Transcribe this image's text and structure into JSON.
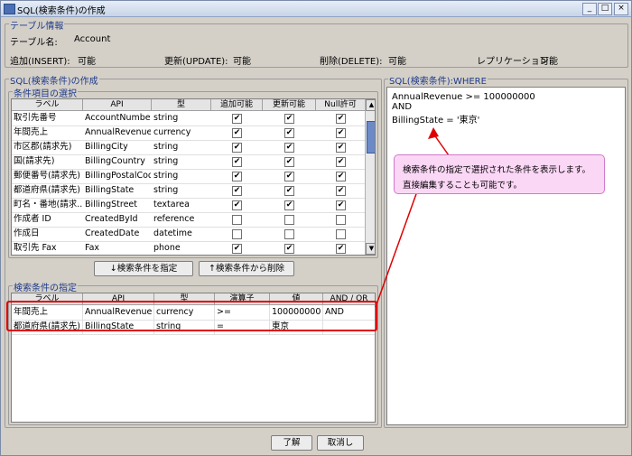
{
  "window": {
    "title": "SQL(検索条件)の作成",
    "controls": [
      "_",
      "□",
      "×"
    ]
  },
  "table_info": {
    "group_title": "テーブル情報",
    "table_label": "テーブル名:",
    "table_value": "Account",
    "insert_label": "追加(INSERT):",
    "insert_value": "可能",
    "update_label": "更新(UPDATE):",
    "update_value": "可能",
    "delete_label": "削除(DELETE):",
    "delete_value": "可能",
    "replication_label": "レプリケーション:",
    "replication_value": "可能"
  },
  "sql_create": {
    "group_title": "SQL(検索条件)の作成",
    "items_group_title": "条件項目の選択",
    "columns": [
      "ラベル",
      "API",
      "型",
      "追加可能",
      "更新可能",
      "Null許可"
    ],
    "rows": [
      {
        "label": "取引先番号",
        "api": "AccountNumber",
        "type": "string",
        "insert": true,
        "update": true,
        "nullable": true
      },
      {
        "label": "年間売上",
        "api": "AnnualRevenue",
        "type": "currency",
        "insert": true,
        "update": true,
        "nullable": true
      },
      {
        "label": "市区郡(請求先)",
        "api": "BillingCity",
        "type": "string",
        "insert": true,
        "update": true,
        "nullable": true
      },
      {
        "label": "国(請求先)",
        "api": "BillingCountry",
        "type": "string",
        "insert": true,
        "update": true,
        "nullable": true
      },
      {
        "label": "郵便番号(請求先)",
        "api": "BillingPostalCode",
        "type": "string",
        "insert": true,
        "update": true,
        "nullable": true
      },
      {
        "label": "都道府県(請求先)",
        "api": "BillingState",
        "type": "string",
        "insert": true,
        "update": true,
        "nullable": true
      },
      {
        "label": "町名・番地(請求...",
        "api": "BillingStreet",
        "type": "textarea",
        "insert": true,
        "update": true,
        "nullable": true
      },
      {
        "label": "作成者 ID",
        "api": "CreatedById",
        "type": "reference",
        "insert": false,
        "update": false,
        "nullable": false
      },
      {
        "label": "作成日",
        "api": "CreatedDate",
        "type": "datetime",
        "insert": false,
        "update": false,
        "nullable": false
      },
      {
        "label": "取引先 Fax",
        "api": "Fax",
        "type": "phone",
        "insert": true,
        "update": true,
        "nullable": true
      }
    ],
    "add_button": "↓検索条件を指定",
    "remove_button": "↑検索条件から削除",
    "criteria_group_title": "検索条件の指定",
    "criteria_columns": [
      "ラベル",
      "API",
      "型",
      "演算子",
      "値",
      "AND / OR"
    ],
    "criteria_rows": [
      {
        "label": "年間売上",
        "api": "AnnualRevenue",
        "type": "currency",
        "operator": ">=",
        "value": "100000000",
        "andor": "AND"
      },
      {
        "label": "都道府県(請求先)",
        "api": "BillingState",
        "type": "string",
        "operator": "=",
        "value": "東京",
        "andor": ""
      }
    ]
  },
  "where_panel": {
    "group_title": "SQL(検索条件):WHERE",
    "lines": [
      "AnnualRevenue >= 100000000",
      "AND",
      "BillingState = '東京'"
    ]
  },
  "callout": {
    "line1": "検索条件の指定で選択された条件を表示します。",
    "line2": "直接編集することも可能です。"
  },
  "footer": {
    "ok_button": "了解",
    "cancel_button": "取消し"
  },
  "colors": {
    "highlight": "#e00000",
    "callout_bg": "#fbd7f6",
    "group_title": "#1e3a8a"
  }
}
